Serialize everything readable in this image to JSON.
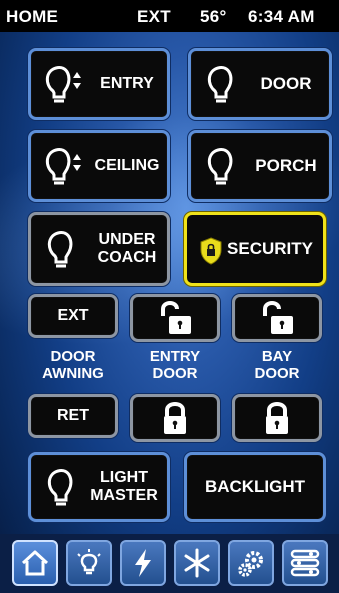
{
  "status": {
    "home": "HOME",
    "ext": "EXT",
    "temp": "56°",
    "time": "6:34 AM"
  },
  "lights": {
    "entry": "ENTRY",
    "door": "DOOR",
    "ceiling": "CEILING",
    "porch": "PORCH",
    "under_coach": "UNDER\nCOACH",
    "security": "SECURITY",
    "light_master": "LIGHT\nMASTER",
    "backlight": "BACKLIGHT"
  },
  "awning": {
    "ext": "EXT",
    "door_awning": "DOOR\nAWNING",
    "ret": "RET"
  },
  "locks": {
    "entry_door": "ENTRY\nDOOR",
    "bay_door": "BAY\nDOOR"
  },
  "nav": [
    "home-icon",
    "lightbulb-icon",
    "power-icon",
    "snowflake-icon",
    "gears-icon",
    "settings-sliders-icon"
  ],
  "colors": {
    "accent": "#5d8fd8",
    "security": "#f0e21a",
    "background": "#123e86"
  }
}
